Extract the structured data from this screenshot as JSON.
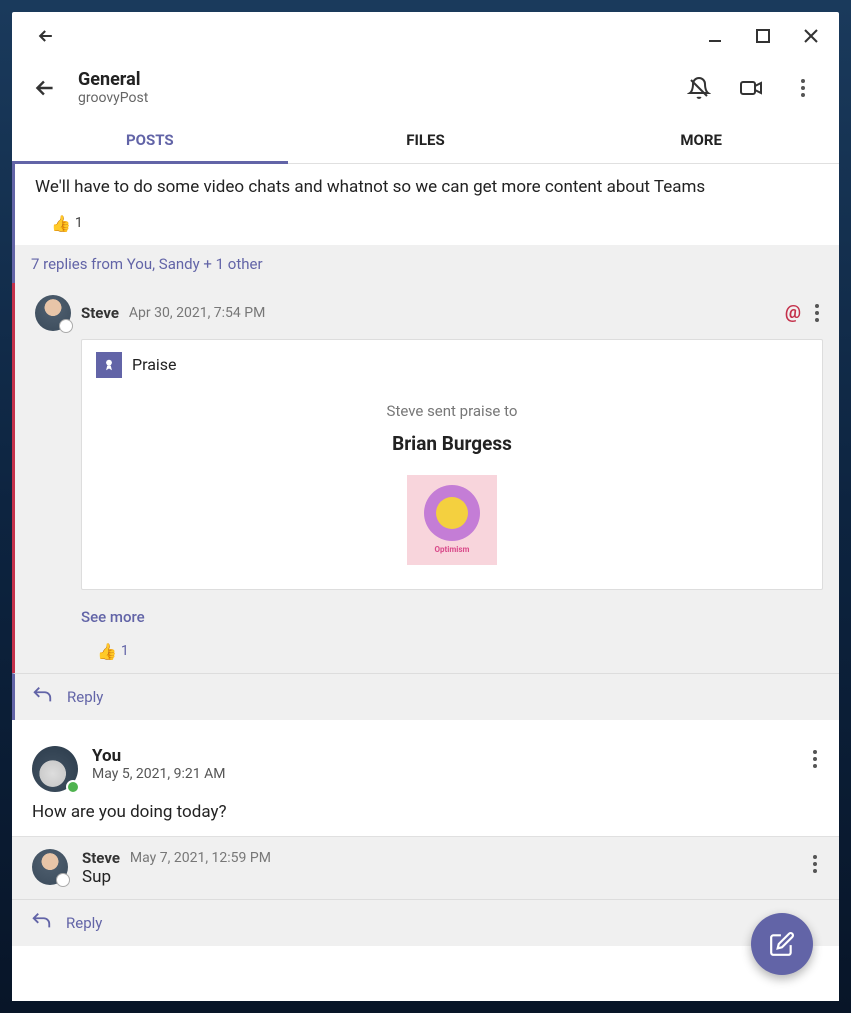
{
  "header": {
    "channel": "General",
    "team": "groovyPost"
  },
  "tabs": {
    "posts": "POSTS",
    "files": "FILES",
    "more": "MORE"
  },
  "thread1": {
    "message": "We'll have to do some video chats and whatnot so we can get more content about Teams",
    "reaction_count": "1",
    "replies_summary": "7 replies from You, Sandy + 1 other",
    "reply": {
      "author": "Steve",
      "timestamp": "Apr 30, 2021, 7:54 PM",
      "praise_label": "Praise",
      "praise_sent": "Steve sent praise to",
      "praise_recipient": "Brian Burgess",
      "sticker_label": "Optimism",
      "see_more": "See more",
      "reaction_count": "1"
    },
    "reply_action": "Reply"
  },
  "thread2": {
    "author": "You",
    "timestamp": "May 5, 2021, 9:21 AM",
    "message": "How are you doing today?",
    "reply": {
      "author": "Steve",
      "timestamp": "May 7, 2021, 12:59 PM",
      "message": "Sup"
    },
    "reply_action": "Reply"
  }
}
